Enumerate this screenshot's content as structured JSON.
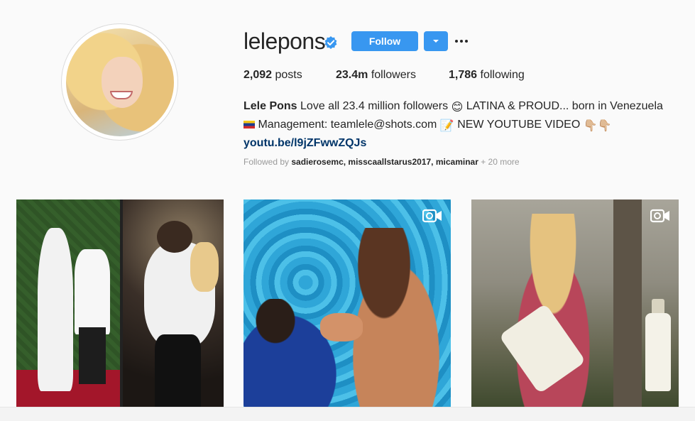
{
  "profile": {
    "username": "lelepons",
    "follow_label": "Follow",
    "stats": {
      "posts_count": "2,092",
      "posts_label": "posts",
      "followers_count": "23.4m",
      "followers_label": "followers",
      "following_count": "1,786",
      "following_label": "following"
    },
    "bio": {
      "name": "Lele Pons",
      "line1_text": "Love all 23.4 million followers",
      "line1_emoji": "😊",
      "line1_tail": "LATINA & PROUD... born in Venezuela",
      "line2_text": "Management: teamlele@shots.com",
      "line2_emoji": "📝",
      "line2_tail": "NEW YOUTUBE VIDEO",
      "line2_pointers": "👇🏼👇🏼",
      "link": "youtu.be/l9jZFwwZQJs"
    },
    "followed_by": {
      "prefix": "Followed by",
      "names": "sadierosemc, misscaallstarus2017, micaminar",
      "more": "+ 20 more"
    }
  },
  "posts": [
    {
      "type": "photo"
    },
    {
      "type": "video"
    },
    {
      "type": "video"
    }
  ],
  "colors": {
    "accent": "#3897f0",
    "verified": "#3897f0",
    "link": "#003569",
    "muted": "#999999"
  },
  "icons": {
    "verified": "verified-badge-icon",
    "dropdown": "chevron-down-icon",
    "more": "more-options-icon",
    "video": "video-camera-icon"
  }
}
